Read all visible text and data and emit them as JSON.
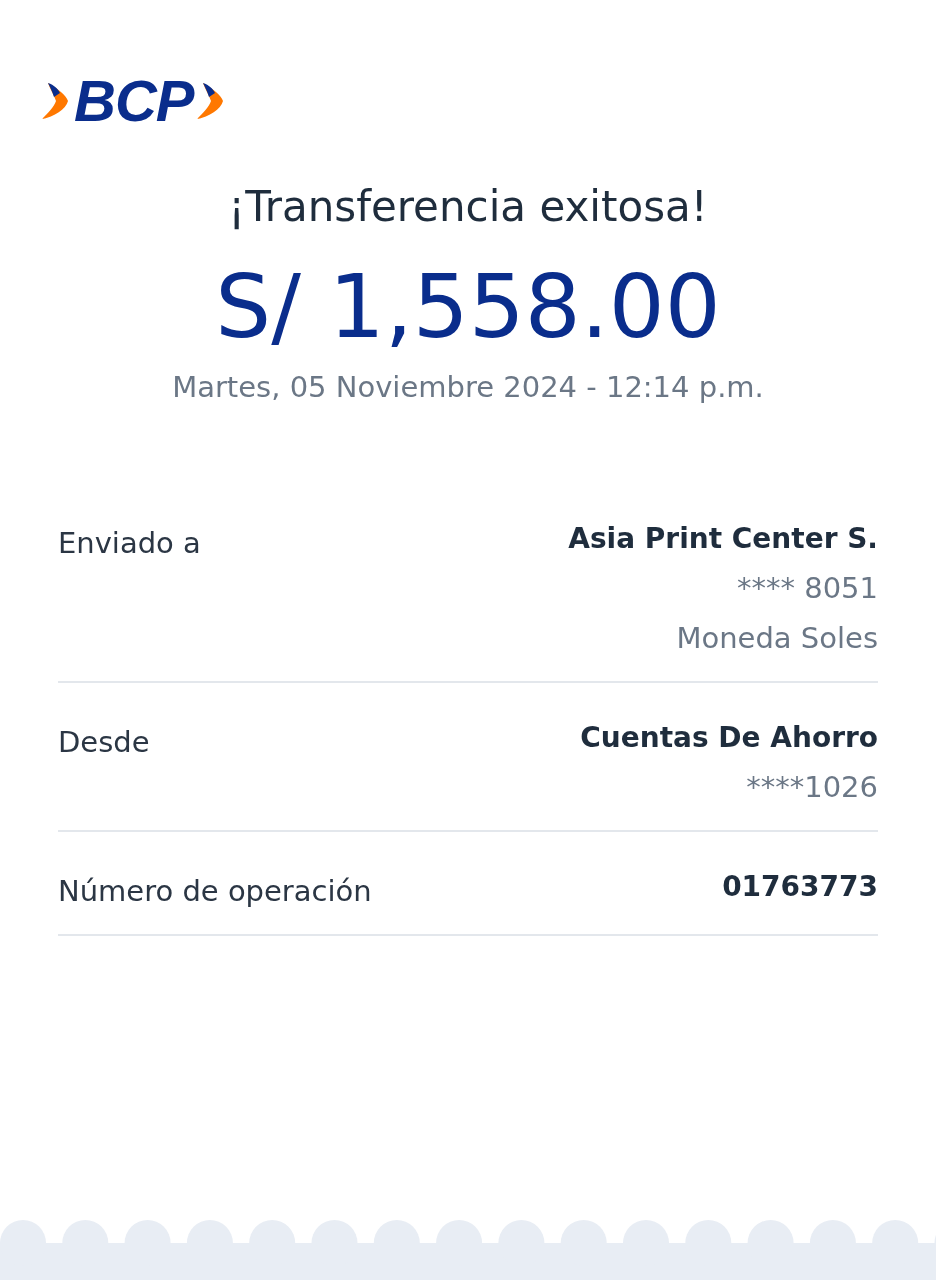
{
  "logo": {
    "text": "BCP"
  },
  "title": "¡Transferencia exitosa!",
  "amount": "S/ 1,558.00",
  "datetime": "Martes, 05 Noviembre 2024 - 12:14 p.m.",
  "details": [
    {
      "label": "Enviado a",
      "values": [
        {
          "text": "Asia Print Center S.",
          "kind": "primary"
        },
        {
          "text": "**** 8051",
          "kind": "secondary"
        },
        {
          "text": "Moneda Soles",
          "kind": "secondary"
        }
      ]
    },
    {
      "label": "Desde",
      "values": [
        {
          "text": "Cuentas De Ahorro",
          "kind": "primary"
        },
        {
          "text": "****1026",
          "kind": "secondary"
        }
      ]
    },
    {
      "label": "Número de operación",
      "values": [
        {
          "text": "01763773",
          "kind": "primary"
        }
      ]
    }
  ]
}
